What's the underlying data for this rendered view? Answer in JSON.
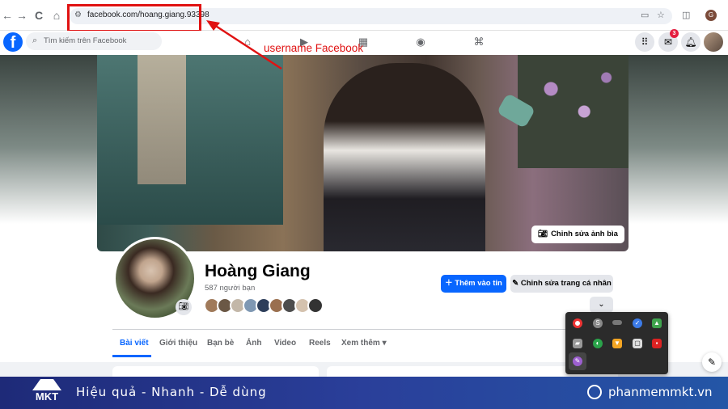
{
  "browser": {
    "url": "facebook.com/hoang.giang.93398",
    "back_icon": "←",
    "forward_icon": "→",
    "reload_icon": "C",
    "home_icon": "⌂",
    "profile_initial": "G"
  },
  "annotation": {
    "label": "username Facebook",
    "color": "#e01212"
  },
  "fb_header": {
    "logo": "f",
    "search_placeholder": "Tìm kiếm trên Facebook",
    "messenger_badge": "3"
  },
  "profile": {
    "name": "Hoàng Giang",
    "friends": "587 người bạn",
    "edit_cover_label": "Chỉnh sửa ảnh bìa",
    "add_story_label": "Thêm vào tin",
    "edit_profile_label": "Chỉnh sửa trang cá nhân"
  },
  "tabs": [
    {
      "label": "Bài viết",
      "active": true
    },
    {
      "label": "Giới thiệu"
    },
    {
      "label": "Bạn bè"
    },
    {
      "label": "Ảnh"
    },
    {
      "label": "Video"
    },
    {
      "label": "Reels"
    },
    {
      "label": "Xem thêm"
    }
  ],
  "banner": {
    "logo_text": "MKT",
    "slogan": "Hiệu quả - Nhanh - Dễ dùng",
    "site": "phanmemmkt.vn"
  },
  "colors": {
    "facebook_blue": "#0866ff",
    "banner_blue": "#1e2a78",
    "highlight_red": "#e01212"
  }
}
